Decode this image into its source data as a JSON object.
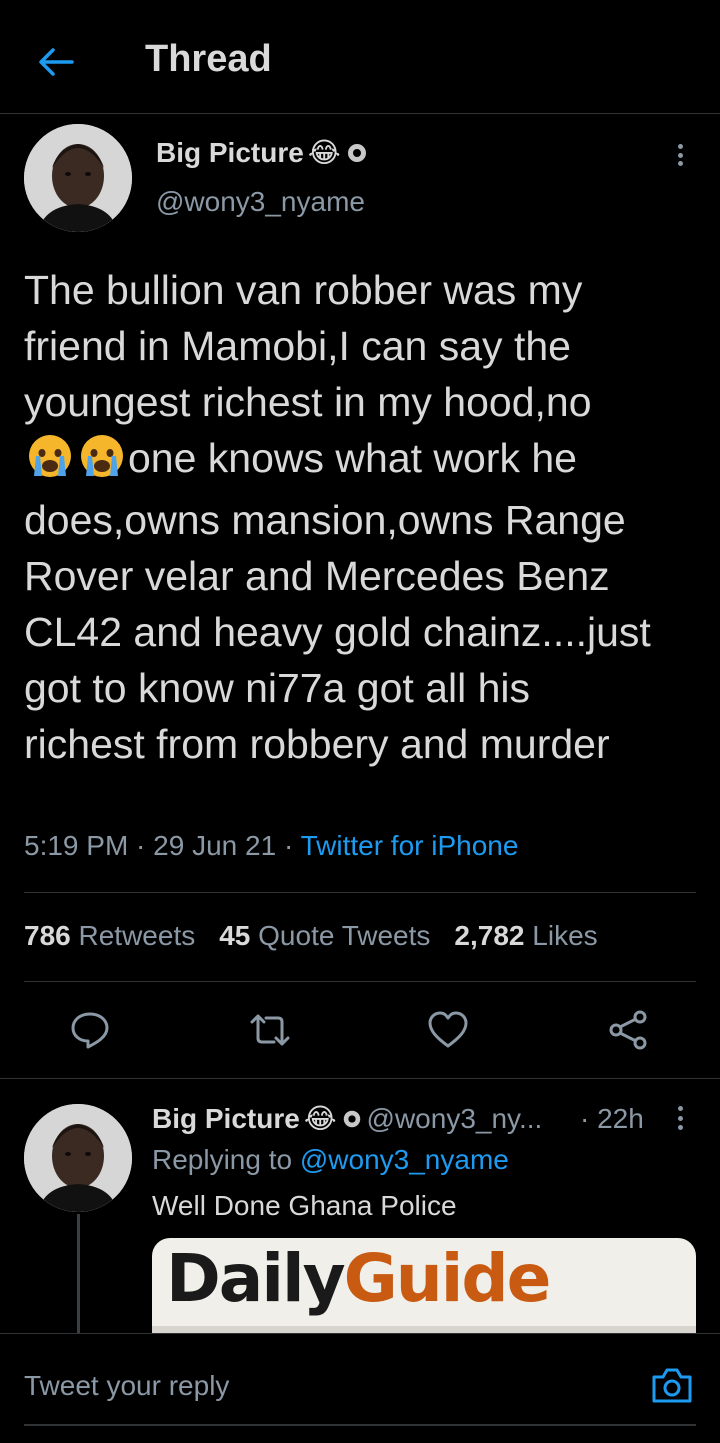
{
  "header": {
    "title": "Thread",
    "back_icon": "arrow-left-icon",
    "accent": "#1d9bf0"
  },
  "main_tweet": {
    "author_name": "Big Picture",
    "author_emoji": "😂",
    "author_handle": "@wony3_nyame",
    "text_lines": [
      "The bullion van robber was my",
      "friend in Mamobi,I can say the",
      "youngest richest in my hood,no",
      "one knows what work he",
      "does,owns mansion,owns Range",
      "Rover velar and Mercedes Benz",
      "CL42 and heavy gold chainz....just",
      "got to know ni77a got all his",
      "richest from robbery and murder",
      "",
      ""
    ],
    "time": "5:19 PM",
    "date": "29 Jun 21",
    "source": "Twitter for iPhone",
    "retweets_count": "786",
    "retweets_label": "Retweets",
    "quotes_count": "45",
    "quotes_label": "Quote Tweets",
    "likes_count": "2,782",
    "likes_label": "Likes"
  },
  "reply_tweet": {
    "author_name": "Big Picture",
    "author_emoji": "😂",
    "author_handle": "@wony3_ny...",
    "time": "· 22h",
    "replying_prefix": "Replying to",
    "replying_mention": "@wony3_nyame",
    "text": "Well Done Ghana Police",
    "media_logo_part1": "Daily",
    "media_logo_part2": "Guide"
  },
  "reply_bar": {
    "placeholder": "Tweet your reply",
    "camera_icon": "camera-icon"
  }
}
